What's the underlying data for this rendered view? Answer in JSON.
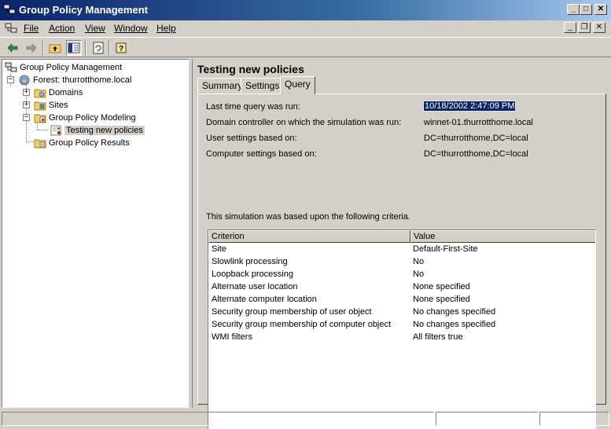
{
  "window": {
    "title": "Group Policy Management"
  },
  "menu": {
    "file": "File",
    "action": "Action",
    "view": "View",
    "window": "Window",
    "help": "Help"
  },
  "tree": {
    "root": "Group Policy Management",
    "forest": "Forest: thurrotthome.local",
    "domains": "Domains",
    "sites": "Sites",
    "modeling": "Group Policy Modeling",
    "testing": "Testing new policies",
    "results": "Group Policy Results"
  },
  "details": {
    "title": "Testing new policies",
    "tabs": [
      "Summary",
      "Settings",
      "Query"
    ],
    "active_tab": "Query",
    "fields": [
      {
        "label": "Last time query was run:",
        "value": "10/18/2002 2:47:09 PM"
      },
      {
        "label": "Domain controller on which the simulation was run:",
        "value": "winnet-01.thurrotthome.local"
      },
      {
        "label": "User settings based on:",
        "value": "DC=thurrotthome,DC=local"
      },
      {
        "label": "Computer settings based on:",
        "value": "DC=thurrotthome,DC=local"
      }
    ],
    "criteria_intro": "This simulation was based upon the following criteria.",
    "columns": {
      "criterion": "Criterion",
      "value": "Value"
    },
    "rows": [
      {
        "criterion": "Site",
        "value": "Default-First-Site"
      },
      {
        "criterion": "Slowlink processing",
        "value": "No"
      },
      {
        "criterion": "Loopback processing",
        "value": "No"
      },
      {
        "criterion": "Alternate user location",
        "value": "None specified"
      },
      {
        "criterion": "Alternate computer location",
        "value": "None specified"
      },
      {
        "criterion": "Security group membership of user object",
        "value": "No changes specified"
      },
      {
        "criterion": "Security group membership of computer object",
        "value": "No changes specified"
      },
      {
        "criterion": "WMI filters",
        "value": "All filters true"
      }
    ]
  },
  "icons": {
    "back": "back-arrow-icon",
    "forward": "forward-arrow-icon",
    "up": "up-folder-icon",
    "showhide": "show-hide-tree-icon",
    "refresh": "refresh-icon",
    "help": "help-icon"
  },
  "colors": {
    "selection": "#0a246a",
    "titlebar": "#0a246a",
    "face": "#d4d0c8"
  }
}
